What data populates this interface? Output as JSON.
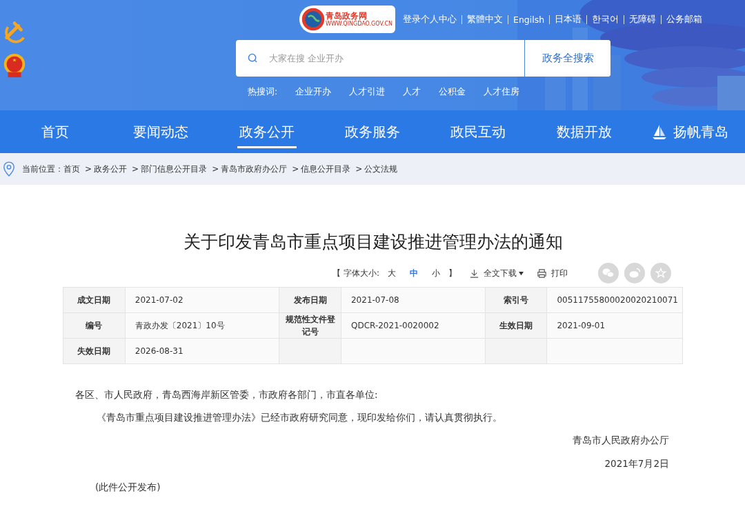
{
  "header": {
    "logo": {
      "title": "青岛政务网",
      "url": "WWW.QINGDAO.GOV.CN"
    },
    "top_links": [
      "登录个人中心",
      "繁體中文",
      "Engilsh",
      "日本语",
      "한국어",
      "无障碍",
      "公务邮箱"
    ],
    "search": {
      "placeholder": "大家在搜 企业开办",
      "button": "政务全搜索"
    },
    "hot_search": {
      "label": "热搜词:",
      "terms": [
        "企业开办",
        "人才引进",
        "人才",
        "公积金",
        "人才住房"
      ]
    }
  },
  "nav": [
    {
      "label": "首页",
      "selected": false
    },
    {
      "label": "要闻动态",
      "selected": false
    },
    {
      "label": "政务公开",
      "selected": true
    },
    {
      "label": "政务服务",
      "selected": false
    },
    {
      "label": "政民互动",
      "selected": false
    },
    {
      "label": "数据开放",
      "selected": false
    },
    {
      "label": "扬帆青岛",
      "selected": false,
      "kind": "brand"
    }
  ],
  "breadcrumb": {
    "label": "当前位置：",
    "separator": ">",
    "items": [
      "首页",
      "政务公开",
      "部门信息公开目录",
      "青岛市政府办公厅",
      "信息公开目录",
      "公文法规"
    ]
  },
  "article": {
    "title": "关于印发青岛市重点项目建设推进管理办法的通知",
    "tools": {
      "font_open": "【 字体大小:",
      "sizes": [
        {
          "label": "大",
          "selected": false
        },
        {
          "label": "中",
          "selected": true
        },
        {
          "label": "小",
          "selected": false
        }
      ],
      "font_close": "】",
      "download": "全文下载",
      "print": "打印"
    },
    "meta": [
      [
        {
          "label": "成文日期",
          "value": "2021-07-02"
        },
        {
          "label": "发布日期",
          "value": "2021-07-08"
        },
        {
          "label": "索引号",
          "value": "00511755800020020210071"
        }
      ],
      [
        {
          "label": "编号",
          "value": "青政办发〔2021〕10号"
        },
        {
          "label": "规范性文件登记号",
          "value": "QDCR-2021-0020002"
        },
        {
          "label": "生效日期",
          "value": "2021-09-01"
        }
      ],
      [
        {
          "label": "失效日期",
          "value": "2026-08-31"
        }
      ]
    ],
    "salutation": "各区、市人民政府，青岛西海岸新区管委，市政府各部门，市直各单位:",
    "paragraph": "《青岛市重点项目建设推进管理办法》已经市政府研究同意，现印发给你们，请认真贯彻执行。",
    "signature": "青岛市人民政府办公厅",
    "date": "2021年7月2日",
    "note": "(此件公开发布)"
  }
}
